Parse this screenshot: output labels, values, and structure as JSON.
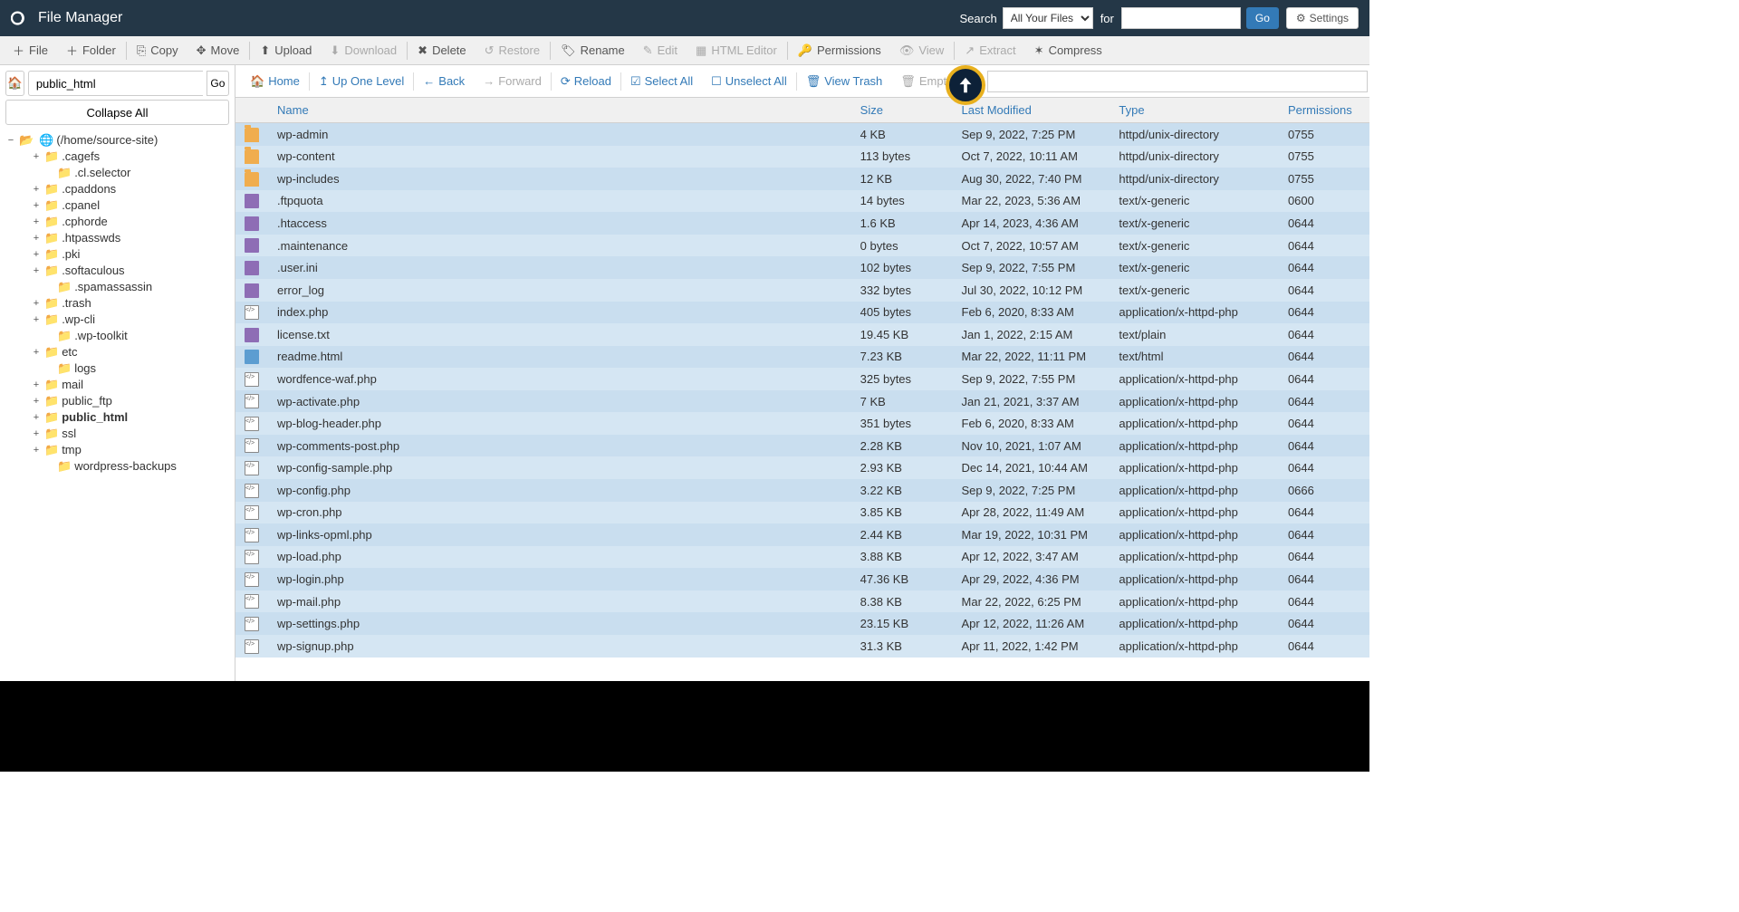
{
  "header": {
    "title": "File Manager",
    "search_label": "Search",
    "search_scope": "All Your Files",
    "for_label": "for",
    "search_value": "",
    "go": "Go",
    "settings": "Settings"
  },
  "toolbar": {
    "file": "File",
    "folder": "Folder",
    "copy": "Copy",
    "move": "Move",
    "upload": "Upload",
    "download": "Download",
    "delete": "Delete",
    "restore": "Restore",
    "rename": "Rename",
    "edit": "Edit",
    "html_editor": "HTML Editor",
    "permissions": "Permissions",
    "view": "View",
    "extract": "Extract",
    "compress": "Compress"
  },
  "left": {
    "path_value": "public_html",
    "go": "Go",
    "collapse_all": "Collapse All",
    "root_label": "(/home/source-site)",
    "tree": [
      {
        "label": ".cagefs",
        "has_children": true,
        "depth": 1
      },
      {
        "label": ".cl.selector",
        "has_children": false,
        "depth": 2
      },
      {
        "label": ".cpaddons",
        "has_children": true,
        "depth": 1
      },
      {
        "label": ".cpanel",
        "has_children": true,
        "depth": 1
      },
      {
        "label": ".cphorde",
        "has_children": true,
        "depth": 1
      },
      {
        "label": ".htpasswds",
        "has_children": true,
        "depth": 1
      },
      {
        "label": ".pki",
        "has_children": true,
        "depth": 1
      },
      {
        "label": ".softaculous",
        "has_children": true,
        "depth": 1
      },
      {
        "label": ".spamassassin",
        "has_children": false,
        "depth": 2
      },
      {
        "label": ".trash",
        "has_children": true,
        "depth": 1
      },
      {
        "label": ".wp-cli",
        "has_children": true,
        "depth": 1
      },
      {
        "label": ".wp-toolkit",
        "has_children": false,
        "depth": 2
      },
      {
        "label": "etc",
        "has_children": true,
        "depth": 1
      },
      {
        "label": "logs",
        "has_children": false,
        "depth": 2
      },
      {
        "label": "mail",
        "has_children": true,
        "depth": 1
      },
      {
        "label": "public_ftp",
        "has_children": true,
        "depth": 1
      },
      {
        "label": "public_html",
        "has_children": true,
        "depth": 1,
        "bold": true
      },
      {
        "label": "ssl",
        "has_children": true,
        "depth": 1
      },
      {
        "label": "tmp",
        "has_children": true,
        "depth": 1
      },
      {
        "label": "wordpress-backups",
        "has_children": false,
        "depth": 2
      }
    ]
  },
  "actionbar": {
    "home": "Home",
    "up_one_level": "Up One Level",
    "back": "Back",
    "forward": "Forward",
    "reload": "Reload",
    "select_all": "Select All",
    "unselect_all": "Unselect All",
    "view_trash": "View Trash",
    "empty_trash": "Empty Trash"
  },
  "columns": {
    "name": "Name",
    "size": "Size",
    "modified": "Last Modified",
    "type": "Type",
    "perms": "Permissions"
  },
  "files": [
    {
      "icon": "folder",
      "name": "wp-admin",
      "size": "4 KB",
      "modified": "Sep 9, 2022, 7:25 PM",
      "type": "httpd/unix-directory",
      "perms": "0755"
    },
    {
      "icon": "folder",
      "name": "wp-content",
      "size": "113 bytes",
      "modified": "Oct 7, 2022, 10:11 AM",
      "type": "httpd/unix-directory",
      "perms": "0755"
    },
    {
      "icon": "folder",
      "name": "wp-includes",
      "size": "12 KB",
      "modified": "Aug 30, 2022, 7:40 PM",
      "type": "httpd/unix-directory",
      "perms": "0755"
    },
    {
      "icon": "text",
      "name": ".ftpquota",
      "size": "14 bytes",
      "modified": "Mar 22, 2023, 5:36 AM",
      "type": "text/x-generic",
      "perms": "0600"
    },
    {
      "icon": "text",
      "name": ".htaccess",
      "size": "1.6 KB",
      "modified": "Apr 14, 2023, 4:36 AM",
      "type": "text/x-generic",
      "perms": "0644"
    },
    {
      "icon": "text",
      "name": ".maintenance",
      "size": "0 bytes",
      "modified": "Oct 7, 2022, 10:57 AM",
      "type": "text/x-generic",
      "perms": "0644"
    },
    {
      "icon": "text",
      "name": ".user.ini",
      "size": "102 bytes",
      "modified": "Sep 9, 2022, 7:55 PM",
      "type": "text/x-generic",
      "perms": "0644"
    },
    {
      "icon": "text",
      "name": "error_log",
      "size": "332 bytes",
      "modified": "Jul 30, 2022, 10:12 PM",
      "type": "text/x-generic",
      "perms": "0644"
    },
    {
      "icon": "php",
      "name": "index.php",
      "size": "405 bytes",
      "modified": "Feb 6, 2020, 8:33 AM",
      "type": "application/x-httpd-php",
      "perms": "0644"
    },
    {
      "icon": "text",
      "name": "license.txt",
      "size": "19.45 KB",
      "modified": "Jan 1, 2022, 2:15 AM",
      "type": "text/plain",
      "perms": "0644"
    },
    {
      "icon": "html",
      "name": "readme.html",
      "size": "7.23 KB",
      "modified": "Mar 22, 2022, 11:11 PM",
      "type": "text/html",
      "perms": "0644"
    },
    {
      "icon": "php",
      "name": "wordfence-waf.php",
      "size": "325 bytes",
      "modified": "Sep 9, 2022, 7:55 PM",
      "type": "application/x-httpd-php",
      "perms": "0644"
    },
    {
      "icon": "php",
      "name": "wp-activate.php",
      "size": "7 KB",
      "modified": "Jan 21, 2021, 3:37 AM",
      "type": "application/x-httpd-php",
      "perms": "0644"
    },
    {
      "icon": "php",
      "name": "wp-blog-header.php",
      "size": "351 bytes",
      "modified": "Feb 6, 2020, 8:33 AM",
      "type": "application/x-httpd-php",
      "perms": "0644"
    },
    {
      "icon": "php",
      "name": "wp-comments-post.php",
      "size": "2.28 KB",
      "modified": "Nov 10, 2021, 1:07 AM",
      "type": "application/x-httpd-php",
      "perms": "0644"
    },
    {
      "icon": "php",
      "name": "wp-config-sample.php",
      "size": "2.93 KB",
      "modified": "Dec 14, 2021, 10:44 AM",
      "type": "application/x-httpd-php",
      "perms": "0644"
    },
    {
      "icon": "php",
      "name": "wp-config.php",
      "size": "3.22 KB",
      "modified": "Sep 9, 2022, 7:25 PM",
      "type": "application/x-httpd-php",
      "perms": "0666"
    },
    {
      "icon": "php",
      "name": "wp-cron.php",
      "size": "3.85 KB",
      "modified": "Apr 28, 2022, 11:49 AM",
      "type": "application/x-httpd-php",
      "perms": "0644"
    },
    {
      "icon": "php",
      "name": "wp-links-opml.php",
      "size": "2.44 KB",
      "modified": "Mar 19, 2022, 10:31 PM",
      "type": "application/x-httpd-php",
      "perms": "0644"
    },
    {
      "icon": "php",
      "name": "wp-load.php",
      "size": "3.88 KB",
      "modified": "Apr 12, 2022, 3:47 AM",
      "type": "application/x-httpd-php",
      "perms": "0644"
    },
    {
      "icon": "php",
      "name": "wp-login.php",
      "size": "47.36 KB",
      "modified": "Apr 29, 2022, 4:36 PM",
      "type": "application/x-httpd-php",
      "perms": "0644"
    },
    {
      "icon": "php",
      "name": "wp-mail.php",
      "size": "8.38 KB",
      "modified": "Mar 22, 2022, 6:25 PM",
      "type": "application/x-httpd-php",
      "perms": "0644"
    },
    {
      "icon": "php",
      "name": "wp-settings.php",
      "size": "23.15 KB",
      "modified": "Apr 12, 2022, 11:26 AM",
      "type": "application/x-httpd-php",
      "perms": "0644"
    },
    {
      "icon": "php",
      "name": "wp-signup.php",
      "size": "31.3 KB",
      "modified": "Apr 11, 2022, 1:42 PM",
      "type": "application/x-httpd-php",
      "perms": "0644"
    }
  ]
}
